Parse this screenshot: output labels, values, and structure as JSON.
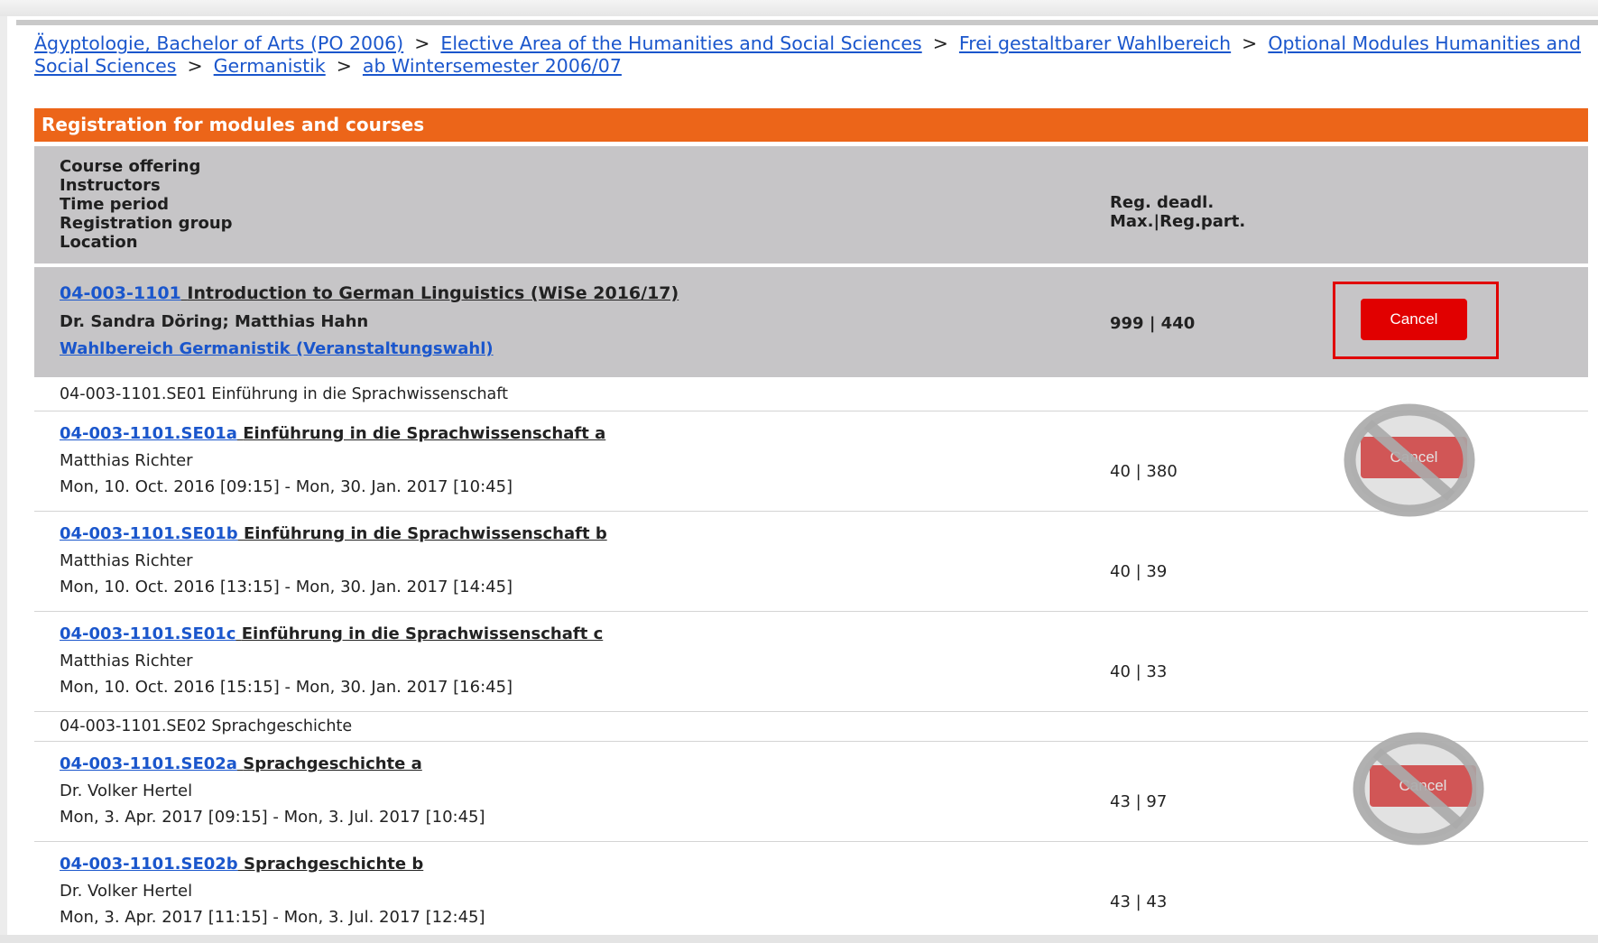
{
  "breadcrumb": {
    "items": [
      "Ägyptologie, Bachelor of Arts (PO 2006)",
      "Elective Area of the Humanities and Social Sciences",
      "Frei gestaltbarer Wahlbereich",
      "Optional Modules Humanities and Social Sciences",
      "Germanistik",
      "ab Wintersemester 2006/07"
    ],
    "separator": ">"
  },
  "panel": {
    "title": "Registration for modules and courses",
    "header": {
      "left": [
        "Course offering",
        "Instructors",
        "Time period",
        "Registration group",
        "Location"
      ],
      "right": [
        "Reg. deadl.",
        "Max.|Reg.part."
      ]
    },
    "course": {
      "code": "04-003-1101",
      "title": "Introduction to German Linguistics (WiSe 2016/17)",
      "instructors": "Dr. Sandra Döring; Matthias Hahn",
      "group": "Wahlbereich Germanistik (Veranstaltungswahl)",
      "max_reg": "999 | 440",
      "cancel_label": "Cancel"
    },
    "groups": [
      {
        "label": "04-003-1101.SE01 Einführung in die Sprachwissenschaft",
        "events": [
          {
            "code": "04-003-1101.SE01a",
            "title": "Einführung in die Sprachwissenschaft a",
            "instructor": "Matthias Richter",
            "period": "Mon, 10. Oct. 2016 [09:15] - Mon, 30. Jan. 2017 [10:45]",
            "max_reg": "40 | 380",
            "cancel_label": "Cancel"
          },
          {
            "code": "04-003-1101.SE01b",
            "title": "Einführung in die Sprachwissenschaft b",
            "instructor": "Matthias Richter",
            "period": "Mon, 10. Oct. 2016 [13:15] - Mon, 30. Jan. 2017 [14:45]",
            "max_reg": "40 | 39"
          },
          {
            "code": "04-003-1101.SE01c",
            "title": "Einführung in die Sprachwissenschaft c",
            "instructor": "Matthias Richter",
            "period": "Mon, 10. Oct. 2016 [15:15] - Mon, 30. Jan. 2017 [16:45]",
            "max_reg": "40 | 33"
          }
        ]
      },
      {
        "label": "04-003-1101.SE02 Sprachgeschichte",
        "events": [
          {
            "code": "04-003-1101.SE02a",
            "title": "Sprachgeschichte a",
            "instructor": "Dr. Volker Hertel",
            "period": "Mon, 3. Apr. 2017 [09:15] - Mon, 3. Jul. 2017 [10:45]",
            "max_reg": "43 | 97",
            "cancel_label": "Cancel"
          },
          {
            "code": "04-003-1101.SE02b",
            "title": "Sprachgeschichte b",
            "instructor": "Dr. Volker Hertel",
            "period": "Mon, 3. Apr. 2017 [11:15] - Mon, 3. Jul. 2017 [12:45]",
            "max_reg": "43 | 43"
          }
        ]
      }
    ]
  },
  "colors": {
    "accent": "#ec6519",
    "link": "#1a56cc",
    "cancel": "#e10000",
    "header_bg": "#c6c5c7"
  },
  "icons": {
    "disabled_overlay": "prohibited-icon"
  }
}
